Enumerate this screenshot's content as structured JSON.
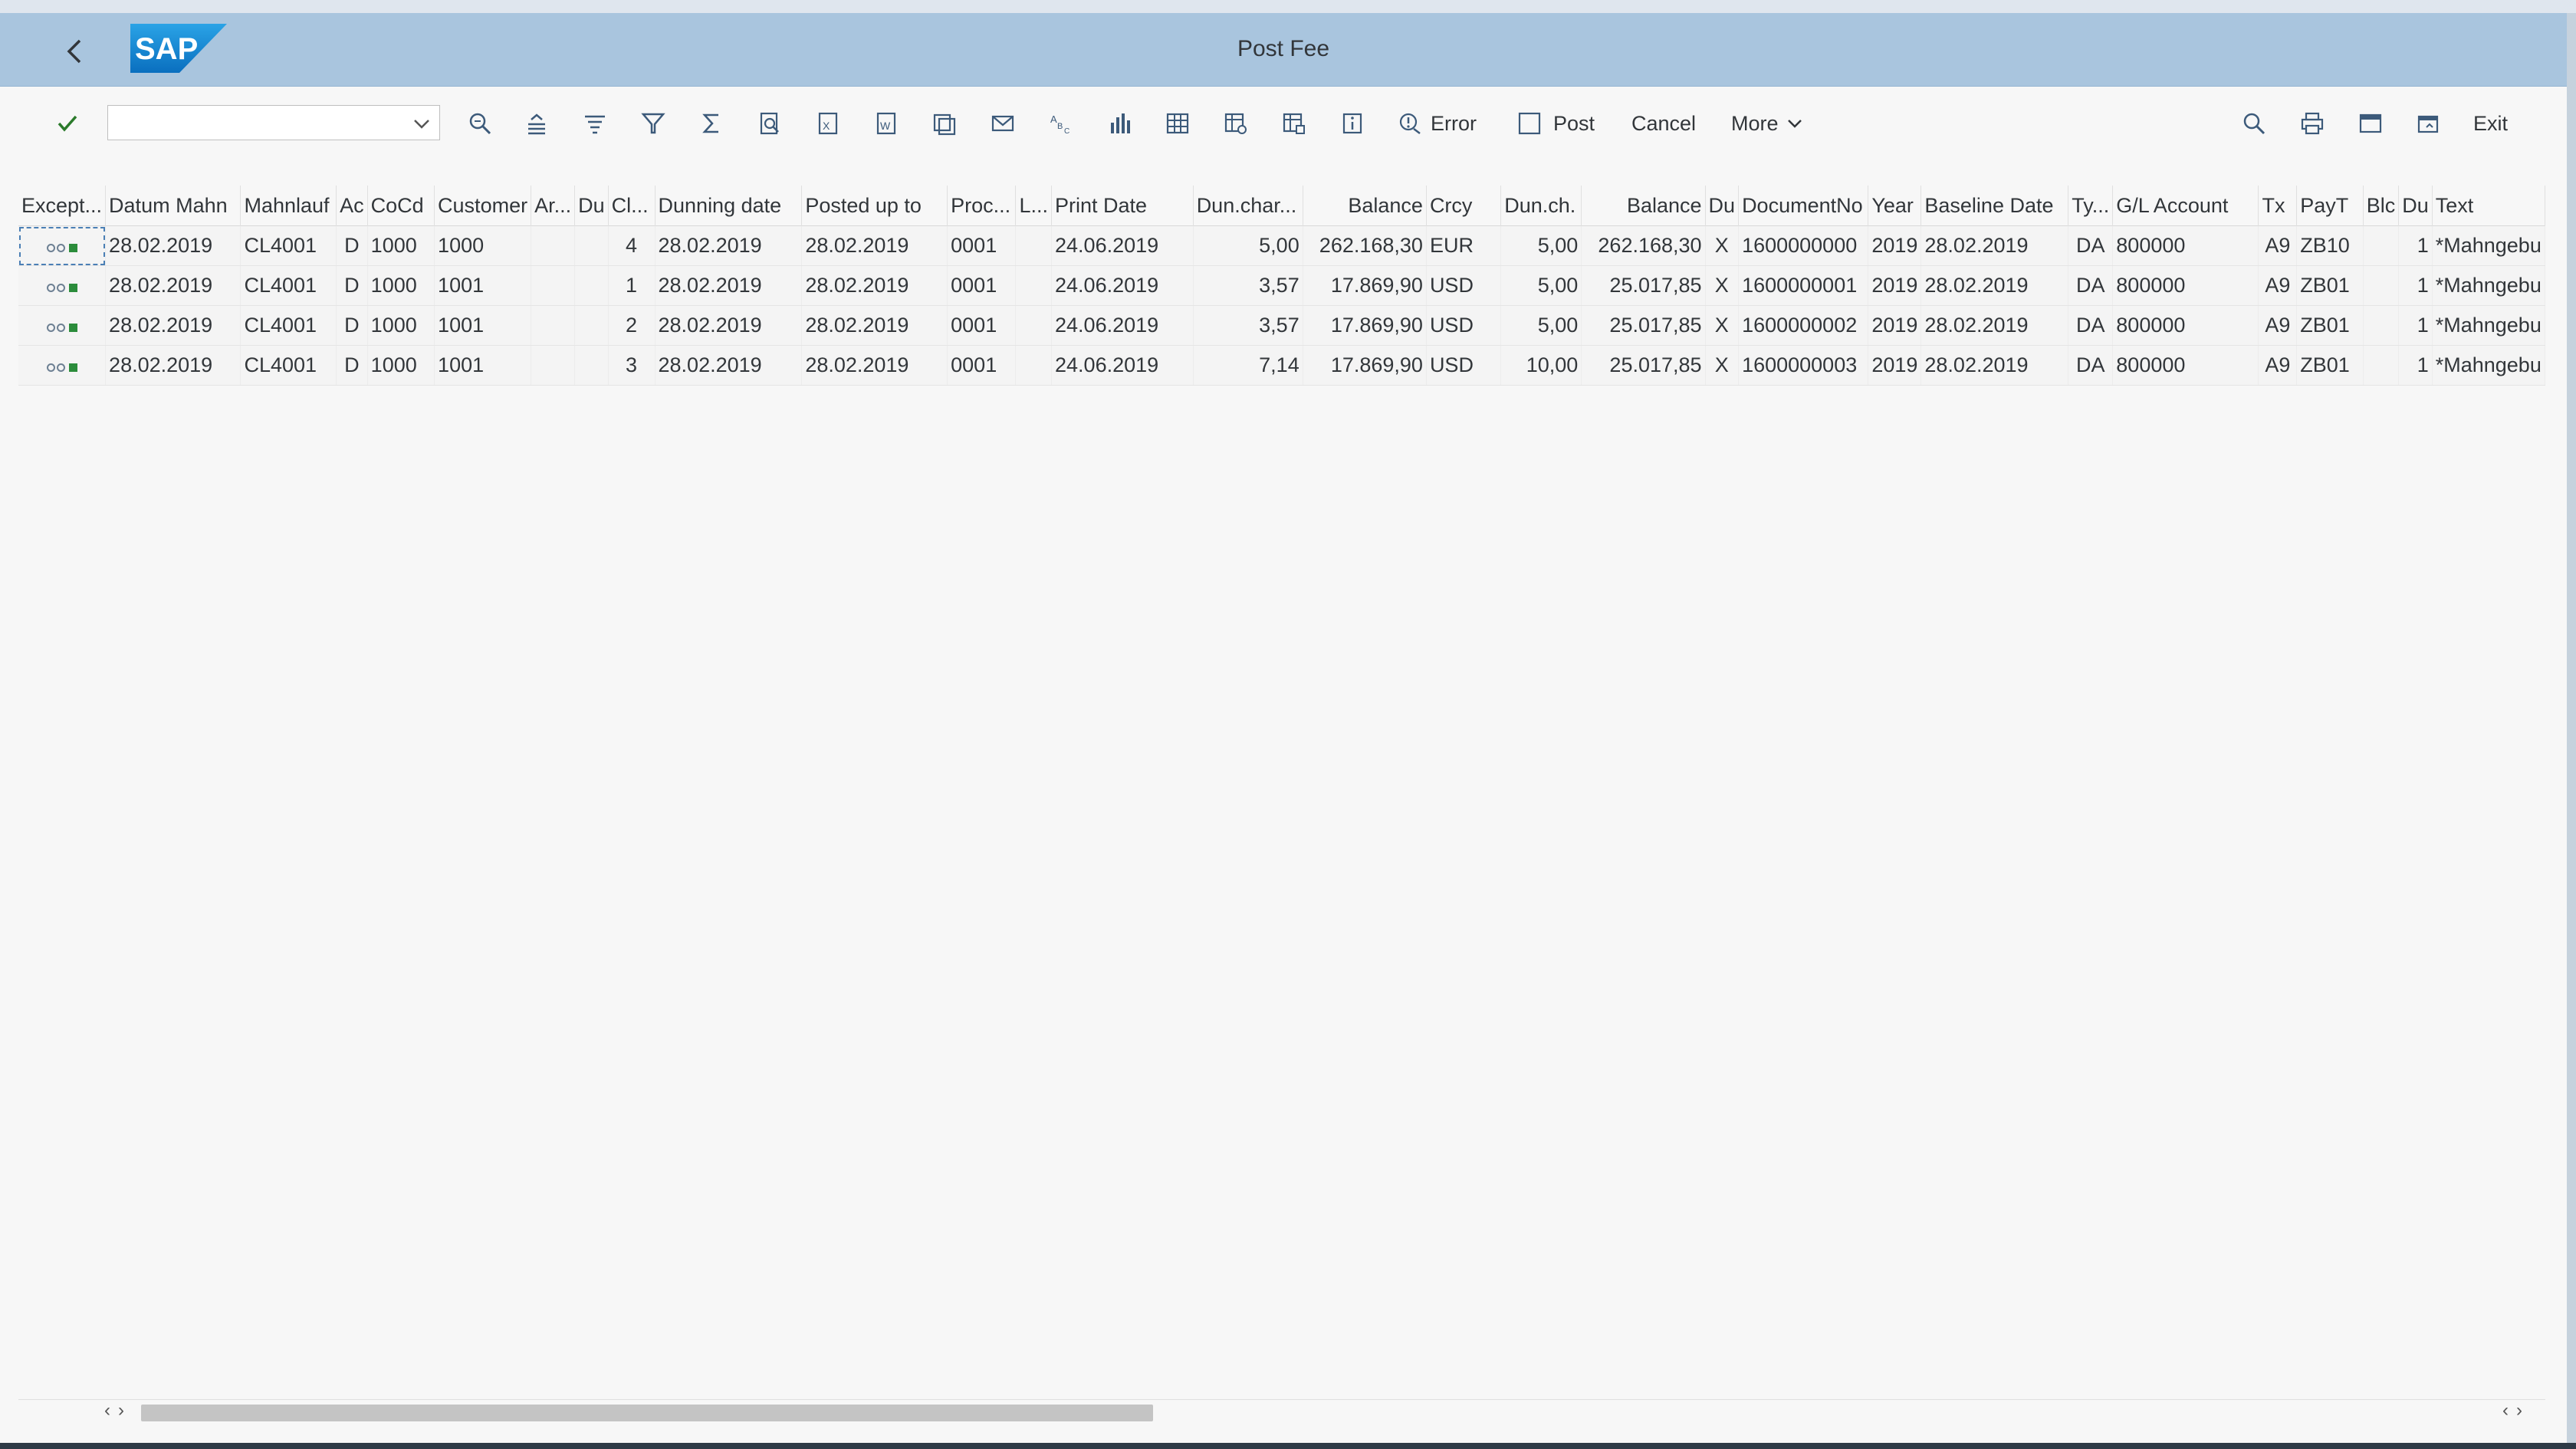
{
  "header": {
    "title": "Post Fee",
    "logo_text": "SAP"
  },
  "toolbar": {
    "command_value": "",
    "error_label": "Error",
    "post_label": "Post",
    "cancel_label": "Cancel",
    "more_label": "More",
    "exit_label": "Exit"
  },
  "table": {
    "columns": [
      "Except...",
      "Datum Mahn",
      "Mahnlauf",
      "Ac",
      "CoCd",
      "Customer",
      "Ar...",
      "Du",
      "Cl...",
      "Dunning date",
      "Posted up to",
      "Proc...",
      "L...",
      "Print Date",
      "Dun.char...",
      "Balance",
      "Crcy",
      "Dun.ch.",
      "Balance",
      "Du",
      "DocumentNo",
      "Year",
      "Baseline Date",
      "Ty...",
      "G/L Account",
      "Tx",
      "PayT",
      "Blc",
      "Du",
      "Text"
    ],
    "rows": [
      [
        "",
        "28.02.2019",
        "CL4001",
        "D",
        "1000",
        "1000",
        "",
        "",
        "4",
        "28.02.2019",
        "28.02.2019",
        "0001",
        "",
        "24.06.2019",
        "5,00",
        "262.168,30",
        "EUR",
        "5,00",
        "262.168,30",
        "X",
        "1600000000",
        "2019",
        "28.02.2019",
        "DA",
        "800000",
        "A9",
        "ZB10",
        "",
        "1",
        "*Mahngebu"
      ],
      [
        "",
        "28.02.2019",
        "CL4001",
        "D",
        "1000",
        "1001",
        "",
        "",
        "1",
        "28.02.2019",
        "28.02.2019",
        "0001",
        "",
        "24.06.2019",
        "3,57",
        "17.869,90",
        "USD",
        "5,00",
        "25.017,85",
        "X",
        "1600000001",
        "2019",
        "28.02.2019",
        "DA",
        "800000",
        "A9",
        "ZB01",
        "",
        "1",
        "*Mahngebu"
      ],
      [
        "",
        "28.02.2019",
        "CL4001",
        "D",
        "1000",
        "1001",
        "",
        "",
        "2",
        "28.02.2019",
        "28.02.2019",
        "0001",
        "",
        "24.06.2019",
        "3,57",
        "17.869,90",
        "USD",
        "5,00",
        "25.017,85",
        "X",
        "1600000002",
        "2019",
        "28.02.2019",
        "DA",
        "800000",
        "A9",
        "ZB01",
        "",
        "1",
        "*Mahngebu"
      ],
      [
        "",
        "28.02.2019",
        "CL4001",
        "D",
        "1000",
        "1001",
        "",
        "",
        "3",
        "28.02.2019",
        "28.02.2019",
        "0001",
        "",
        "24.06.2019",
        "7,14",
        "17.869,90",
        "USD",
        "10,00",
        "25.017,85",
        "X",
        "1600000003",
        "2019",
        "28.02.2019",
        "DA",
        "800000",
        "A9",
        "ZB01",
        "",
        "1",
        "*Mahngebu"
      ]
    ]
  },
  "colors": {
    "header_bg": "#a9c5de",
    "exception_green": "#2b8c3b",
    "sap_blue": "#1a73c1"
  }
}
